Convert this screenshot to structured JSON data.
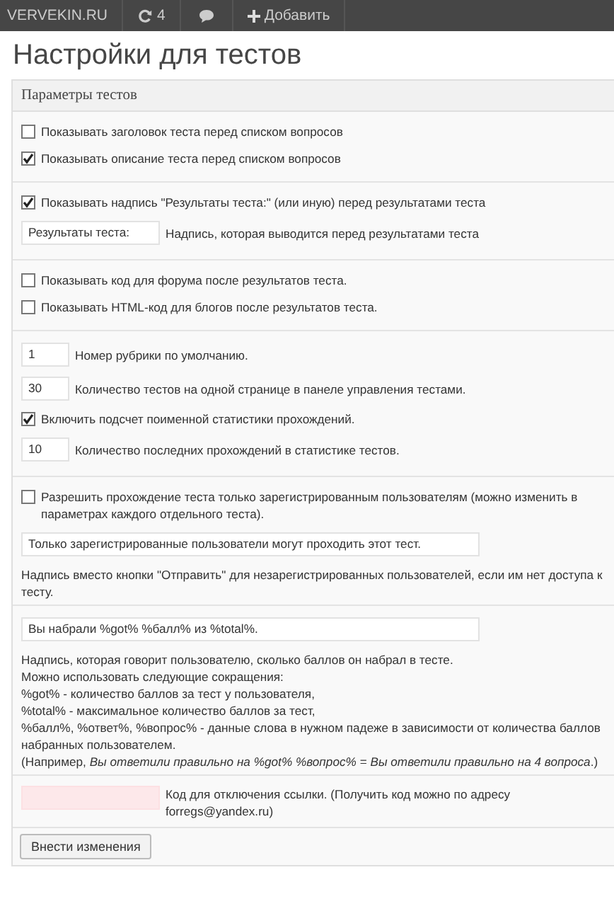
{
  "topbar": {
    "site": "VERVEKIN.RU",
    "updates_count": "4",
    "add_label": "Добавить"
  },
  "page_title": "Настройки для тестов",
  "panel": {
    "title": "Параметры тестов",
    "sections": [
      {
        "items": [
          {
            "kind": "checkbox",
            "checked": false,
            "label": "Показывать заголовок теста перед списком вопросов"
          },
          {
            "kind": "checkbox",
            "checked": true,
            "label": "Показывать описание теста перед списком вопросов"
          }
        ]
      },
      {
        "items": [
          {
            "kind": "checkbox",
            "checked": true,
            "label": "Показывать надпись \"Результаты теста:\" (или иную) перед результатами теста"
          },
          {
            "kind": "input",
            "value": "Результаты теста:",
            "description": "Надпись, которая выводится перед результатами теста"
          }
        ]
      },
      {
        "items": [
          {
            "kind": "checkbox",
            "checked": false,
            "label": "Показывать код для форума после результатов теста."
          },
          {
            "kind": "checkbox",
            "checked": false,
            "label": "Показывать HTML-код для блогов после результатов теста."
          }
        ]
      },
      {
        "items": [
          {
            "kind": "small_input",
            "value": "1",
            "description": "Номер рубрики по умолчанию."
          },
          {
            "kind": "small_input",
            "value": "30",
            "description": "Количество тестов на одной странице в панеле управления тестами."
          },
          {
            "kind": "checkbox",
            "checked": true,
            "label": "Включить подсчет поименной статистики прохождений."
          },
          {
            "kind": "small_input",
            "value": "10",
            "description": "Количество последних прохождений в статистике тестов."
          }
        ]
      },
      {
        "items": [
          {
            "kind": "checkbox",
            "checked": false,
            "label": "Разрешить прохождение теста только зарегистрированным пользователям (можно изменить в параметрах каждого отдельного теста)."
          },
          {
            "kind": "wide_input",
            "value": "Только зарегистрированные пользователи могут проходить этот тест.",
            "lines": [
              "Надпись вместо кнопки \"Отправить\" для незарегистрированных пользователей, если им нет доступа к тесту."
            ]
          }
        ]
      },
      {
        "items": [
          {
            "kind": "wide_input",
            "value": "Вы набрали %got% %балл% из %total%.",
            "lines": [
              "Надпись, которая говорит пользователю, сколько баллов он набрал в тесте.",
              "Можно использовать следующие сокращения:",
              "%got% - количество баллов за тест у пользователя,",
              "%total% - максимальное количество баллов за тест,",
              "%балл%, %ответ%, %вопрос% - данные слова в нужном падеже в зависимости от количества баллов набранных пользователем.",
              "(Например, *Вы ответили правильно на %got% %вопрос% = Вы ответили правильно на 4 вопроса*.)"
            ]
          }
        ]
      },
      {
        "items": [
          {
            "kind": "code_input",
            "value": "",
            "invalid": true,
            "label": "Код для отключения ссылки. (Получить код можно по адресу forregs@yandex.ru)"
          }
        ]
      }
    ],
    "submit": "Внести изменения"
  }
}
